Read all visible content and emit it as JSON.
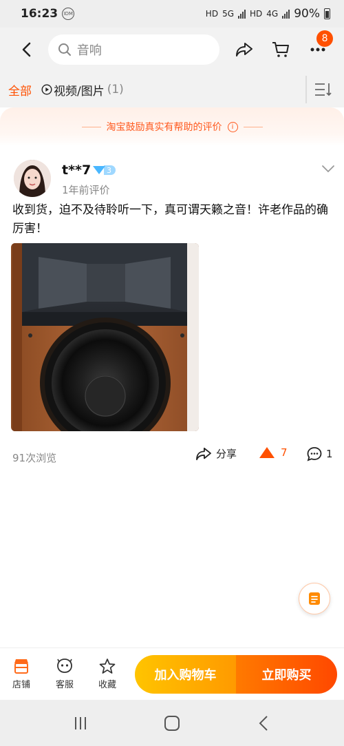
{
  "status_bar": {
    "time": "16:23",
    "idm": "IDM",
    "hd1": "HD",
    "net1": "5G",
    "hd2": "HD",
    "net2": "4G",
    "battery": "90%"
  },
  "header": {
    "search_text": "音响",
    "badge_count": "8"
  },
  "filter": {
    "all_label": "全部",
    "video_label": "视频/图片",
    "video_count": "(1)"
  },
  "notice": {
    "text": "淘宝鼓励真实有帮助的评价",
    "info": "i"
  },
  "review": {
    "username": "t**7",
    "level": "3",
    "time": "1年前评价",
    "text": "收到货，迫不及待聆听一下，真可谓天籁之音！许老作品的确厉害！",
    "views": "91次浏览",
    "share_label": "分享",
    "like_count": "7",
    "comment_count": "1"
  },
  "bottom_bar": {
    "store": "店铺",
    "service": "客服",
    "favorite": "收藏",
    "add_cart": "加入购物车",
    "buy_now": "立即购买"
  },
  "colors": {
    "accent": "#ff5000",
    "add_cart": "#ffb000",
    "buy_now": "#ff5a00"
  }
}
